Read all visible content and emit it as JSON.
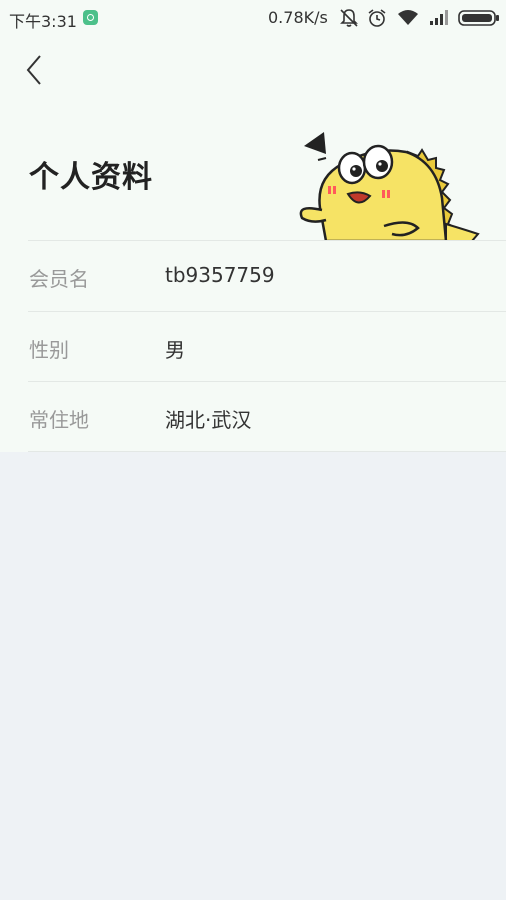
{
  "status_bar": {
    "time": "下午3:31",
    "net_speed": "0.78K/s",
    "icons": [
      "app-notification-icon",
      "mute-bell-icon",
      "alarm-clock-icon",
      "wifi-icon",
      "signal-icon",
      "battery-icon"
    ]
  },
  "header": {
    "back_icon": "chevron-left-icon",
    "title": "个人资料",
    "mascot": "cartoon-fish-mascot"
  },
  "profile": {
    "rows": [
      {
        "label": "会员名",
        "value": "tb9357759"
      },
      {
        "label": "性别",
        "value": "男"
      },
      {
        "label": "常住地",
        "value": "湖北·武汉"
      }
    ]
  },
  "colors": {
    "header_bg": "#f5faf6",
    "page_bg": "#eef2f5",
    "mascot_yellow": "#f6e365",
    "accent_green": "#4cc08a"
  }
}
